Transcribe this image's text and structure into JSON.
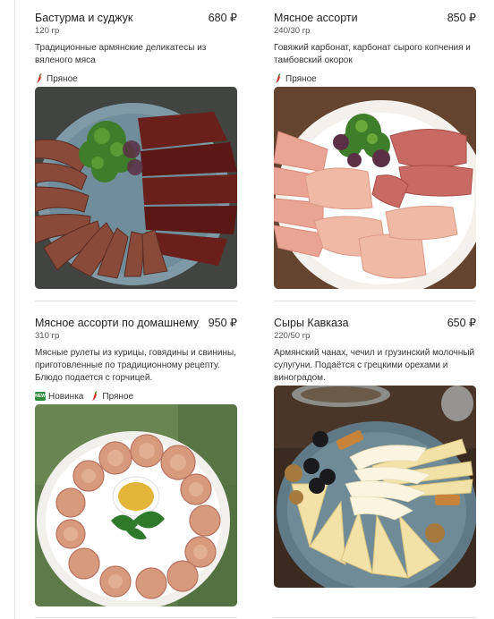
{
  "products": [
    {
      "title": "Бастурма и суджук",
      "price": "680 ₽",
      "weight": "120 гр",
      "description": "Традиционные армянские деликатесы из вяленого мяса",
      "tags": {
        "spicy": "Пряное"
      }
    },
    {
      "title": "Мясное ассорти",
      "price": "850 ₽",
      "weight": "240/30 гр",
      "description": "Говяжий карбонат, карбонат сырого копчения и тамбовский окорок",
      "tags": {
        "spicy": "Пряное"
      }
    },
    {
      "title": "Мясное ассорти по домашнему",
      "price": "950 ₽",
      "weight": "310 гр",
      "description": "Мясные рулеты из курицы, говядины и свинины, приготовленные по традиционному рецепту. Блюдо подается с горчицей.",
      "tags": {
        "new": "Новинка",
        "spicy": "Пряное",
        "new_badge": "NEW"
      }
    },
    {
      "title": "Сыры Кавказа",
      "price": "650 ₽",
      "weight": "220/50 гр",
      "description": "Армянский чанах, чечил и грузинский молочный сулугуни. Подаётся с грецкими орехами и виноградом.",
      "tags": {}
    }
  ],
  "icons": {
    "spicy": "chili-pepper-icon",
    "new": "new-badge-icon"
  },
  "colors": {
    "chili": "#c62d1f",
    "chili_stem": "#3c8a2e",
    "new_badge": "#2e8b3d"
  }
}
